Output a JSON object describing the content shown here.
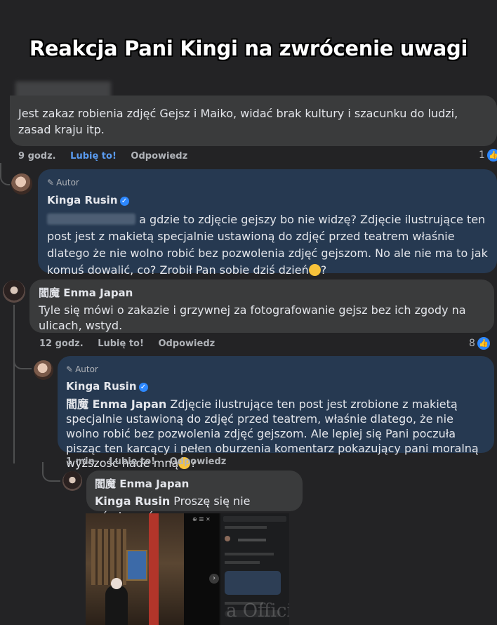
{
  "title": "Reakcja Pani Kingi na zwrócenie uwagi",
  "comment1": {
    "text": "Jest zakaz robienia zdjęć Gejsz i Maiko, widać brak kultury i szacunku do ludzi, zasad kraju itp.",
    "time": "9 godz.",
    "like": "Lubię to!",
    "reply": "Odpowiedz",
    "reactions": "1"
  },
  "reply1": {
    "author_tag": "Autor",
    "name": "Kinga Rusin",
    "text": "a gdzie to zdjęcie gejszy bo nie widzę? Zdjęcie ilustrujące ten post jest z makietą specjalnie ustawioną do zdjęć przed teatrem właśnie dlatego że nie wolno robić bez pozwolenia zdjęć gejszom. No ale nie ma to jak komuś dowalić, co? Zrobił Pan sobie dziś dzień",
    "text_end": "?"
  },
  "comment2": {
    "name": "閻魔 Enma Japan",
    "text": "Tyle się mówi o zakazie i grzywnej za fotografowanie gejsz bez ich zgody na ulicach, wstyd.",
    "time": "12 godz.",
    "like": "Lubię to!",
    "reply": "Odpowiedz",
    "reactions": "8"
  },
  "reply2": {
    "author_tag": "Autor",
    "name": "Kinga Rusin",
    "mention": "閻魔 Enma Japan",
    "text": "Zdjęcie ilustrujące ten post jest zrobione z makietą specjalnie ustawioną do zdjęć przed teatrem, właśnie dlatego, że nie wolno robić bez pozwolenia zdjęć gejszom. Ale lepiej się Pani poczuła pisząc ten karcący i pełen oburzenia komentarz pokazujący pani moralną wyższość nade mną",
    "text_end": "?",
    "time": "1 min",
    "like": "Lubię to!",
    "reply": "Odpowiedz"
  },
  "reply3": {
    "name": "閻魔 Enma Japan",
    "mention": "Kinga Rusin",
    "text": "Proszę się nie ośmieszać"
  },
  "watermark": "a Official"
}
